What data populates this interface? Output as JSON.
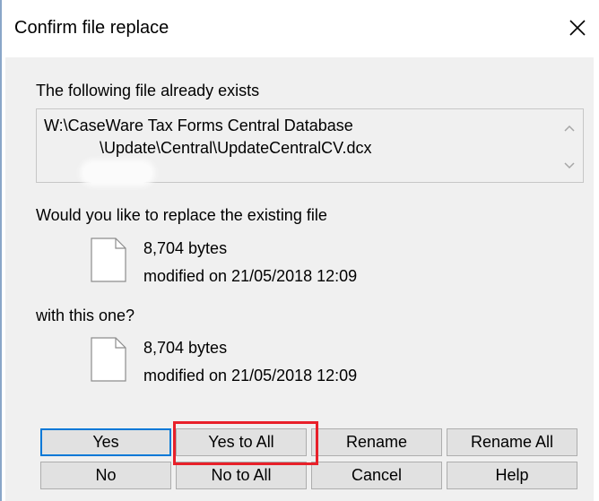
{
  "window": {
    "title": "Confirm file replace"
  },
  "message": {
    "exists_label": "The following file already exists",
    "path_line1": "W:\\CaseWare Tax Forms Central Database",
    "path_line2": "\\Update\\Central\\UpdateCentralCV.dcx",
    "replace_question": "Would you like to replace the existing file",
    "with_label": "with this one?"
  },
  "existing_file": {
    "size": "8,704 bytes",
    "modified": "modified on 21/05/2018 12:09"
  },
  "new_file": {
    "size": "8,704 bytes",
    "modified": "modified on 21/05/2018 12:09"
  },
  "buttons": {
    "yes": "Yes",
    "yes_to_all": "Yes to All",
    "rename": "Rename",
    "rename_all": "Rename All",
    "no": "No",
    "no_to_all": "No to All",
    "cancel": "Cancel",
    "help": "Help"
  },
  "colors": {
    "default_button_border": "#0078d7",
    "annotation_highlight": "#e8202a"
  }
}
